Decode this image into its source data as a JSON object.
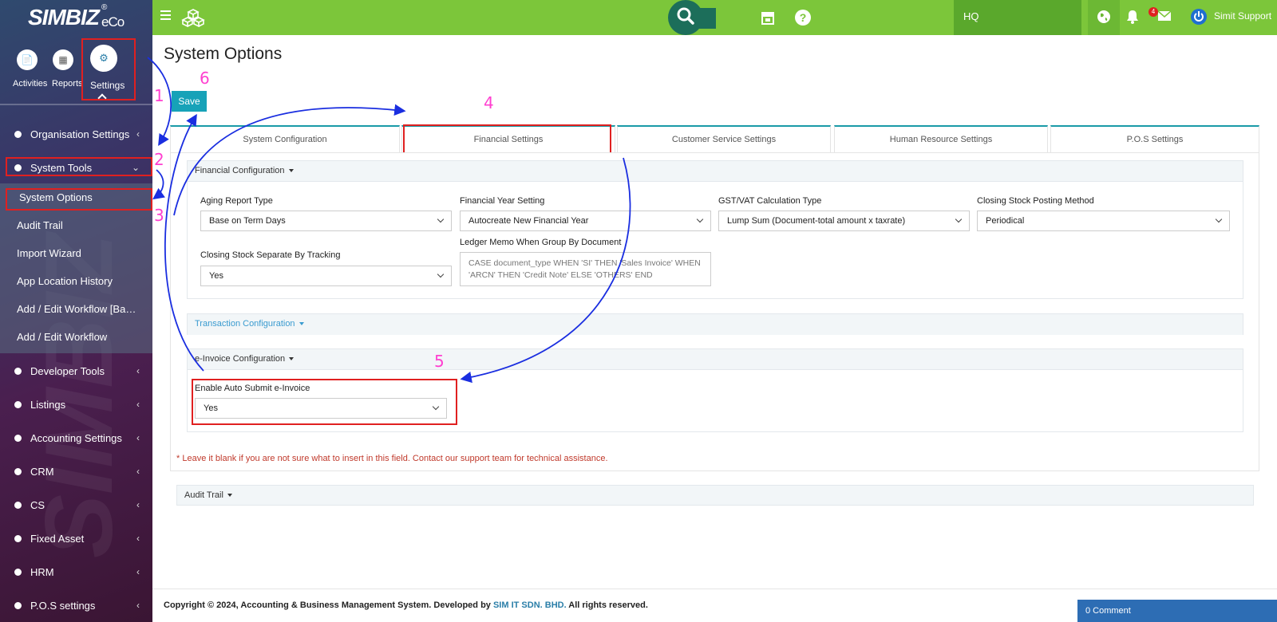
{
  "app": {
    "logo": "SIMBIZ",
    "logo_suffix": "eCo",
    "logo_reg": "®",
    "watermark": "SIMBIZ"
  },
  "sidebar": {
    "top_icons": [
      {
        "label": "Activities",
        "icon": "document-icon"
      },
      {
        "label": "Reports",
        "icon": "report-icon"
      },
      {
        "label": "Settings",
        "icon": "gear-icon"
      }
    ],
    "items": [
      {
        "label": "Organisation Settings",
        "chevron": "‹"
      },
      {
        "label": "System Tools",
        "chevron": "⌄"
      },
      {
        "label": "Developer Tools",
        "chevron": "‹"
      },
      {
        "label": "Listings",
        "chevron": "‹"
      },
      {
        "label": "Accounting Settings",
        "chevron": "‹"
      },
      {
        "label": "CRM",
        "chevron": "‹"
      },
      {
        "label": "CS",
        "chevron": "‹"
      },
      {
        "label": "Fixed Asset",
        "chevron": "‹"
      },
      {
        "label": "HRM",
        "chevron": "‹"
      },
      {
        "label": "P.O.S settings",
        "chevron": "‹"
      }
    ],
    "submenu": [
      "System Options",
      "Audit Trail",
      "Import Wizard",
      "App Location History",
      "Add / Edit Workflow [Ba…",
      "Add / Edit Workflow"
    ]
  },
  "topbar": {
    "branch": "HQ",
    "mail_badge": "4",
    "user": "Simit Support",
    "accent": "#7cc63a"
  },
  "page": {
    "title": "System Options",
    "save_label": "Save"
  },
  "tabs": [
    "System Configuration",
    "Financial Settings",
    "Customer Service Settings",
    "Human Resource Settings",
    "P.O.S Settings"
  ],
  "financial": {
    "title": "Financial Configuration",
    "aging_label": "Aging Report Type",
    "aging_value": "Base on Term Days",
    "fy_label": "Financial Year Setting",
    "fy_value": "Autocreate New Financial Year",
    "gst_label": "GST/VAT Calculation Type",
    "gst_value": "Lump Sum (Document-total amount x taxrate)",
    "closing_label": "Closing Stock Posting Method",
    "closing_value": "Periodical",
    "separate_label": "Closing Stock Separate By Tracking",
    "separate_value": "Yes",
    "memo_label": "Ledger Memo When Group By Document",
    "memo_value": "CASE document_type WHEN 'SI' THEN 'Sales Invoice' WHEN 'ARCN' THEN 'Credit Note' ELSE 'OTHERS' END"
  },
  "transaction": {
    "title": "Transaction Configuration"
  },
  "einvoice": {
    "title": "e-Invoice Configuration",
    "auto_label": "Enable Auto Submit e-Invoice",
    "auto_value": "Yes"
  },
  "note": "* Leave it blank if you are not sure what to insert in this field. Contact our support team for technical assistance.",
  "audit_title": "Audit Trail",
  "footer": {
    "prefix": "Copyright © 2024, Accounting & Business Management System. Developed by ",
    "company": "SIM IT SDN. BHD.",
    "suffix": " All rights reserved.",
    "comment": "0 Comment"
  },
  "annotations": [
    "1",
    "2",
    "3",
    "4",
    "5",
    "6"
  ]
}
